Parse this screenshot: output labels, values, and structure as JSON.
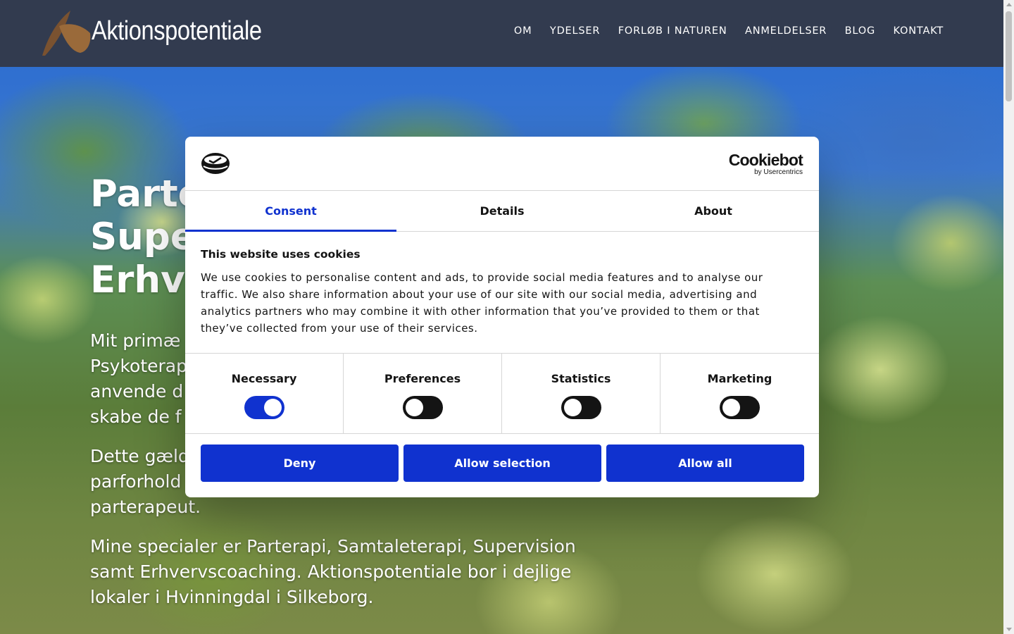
{
  "header": {
    "logo_text": "Aktionspotentiale",
    "nav": [
      "OM",
      "YDELSER",
      "FORLØB I NATUREN",
      "ANMELDELSER",
      "BLOG",
      "KONTAKT"
    ]
  },
  "hero": {
    "title_lines": [
      "Parte",
      "Supe",
      "Erhv"
    ],
    "paragraphs": [
      "Mit primæ\nPsykoterap\nanvende d\nskabe de f",
      "Dette gæld\nparforhold\nparterapeut.",
      "Mine specialer er Parterapi, Samtaleterapi, Supervision\nsamt Erhvervscoaching. Aktionspotentiale bor i dejlige\nlokaler i Hvinningdal i Silkeborg."
    ]
  },
  "cookie_dialog": {
    "brand": {
      "name": "Cookiebot",
      "sub": "by Usercentrics"
    },
    "tabs": [
      "Consent",
      "Details",
      "About"
    ],
    "active_tab": "Consent",
    "title": "This website uses cookies",
    "text": "We use cookies to personalise content and ads, to provide social media features and to analyse our traffic. We also share information about your use of our site with our social media, advertising and analytics partners who may combine it with other information that you’ve provided to them or that they’ve collected from your use of their services.",
    "toggles": [
      {
        "label": "Necessary",
        "on": true
      },
      {
        "label": "Preferences",
        "on": false
      },
      {
        "label": "Statistics",
        "on": false
      },
      {
        "label": "Marketing",
        "on": false
      }
    ],
    "buttons": {
      "deny": "Deny",
      "allow_selection": "Allow selection",
      "allow_all": "Allow all"
    }
  },
  "colors": {
    "header_bg": "#323b4f",
    "accent": "#1032cf",
    "logo_brown": "#8b5a2b"
  }
}
